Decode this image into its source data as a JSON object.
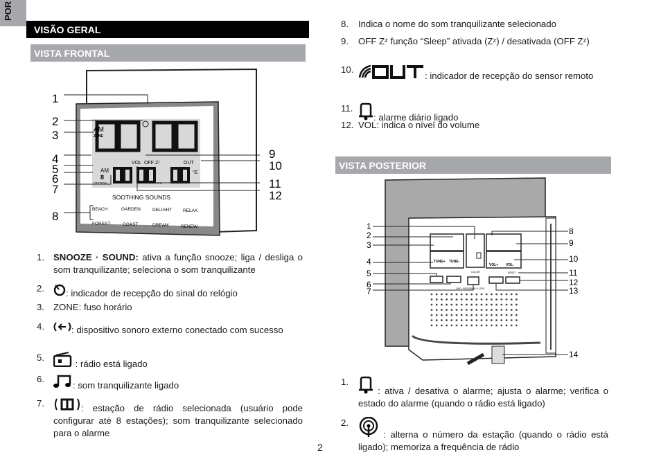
{
  "language_tab": "POR",
  "section_title": "VISÃO GERAL",
  "front_view": {
    "title": "VISTA FRONTAL",
    "diagram": {
      "callouts": [
        "1",
        "2",
        "3",
        "4",
        "5",
        "6",
        "7",
        "8",
        "9",
        "10",
        "11",
        "12"
      ],
      "lcd": {
        "am": "AM",
        "zone": "ZONE",
        "vol": "VOL",
        "off_zz": "OFF Zᶻ",
        "out": "OUT",
        "station": "STATION",
        "station_num": "8",
        "am2": "AM",
        "khz": "KHz",
        "unit": "°E"
      },
      "soothing_sounds": "SOOTHING SOUNDS",
      "sounds": [
        "BEACH",
        "GARDEN",
        "DELIGHT",
        "RELAX",
        "FOREST",
        "COAST",
        "DREAM",
        "RENEW"
      ]
    },
    "items": [
      {
        "num": "1.",
        "bold": "SNOOZE · SOUND:",
        "text": " ativa a função snooze; liga / desliga o som tranquilizante; seleciona o som tranquilizante"
      },
      {
        "num": "2.",
        "icon": "radio-signal-icon",
        "text": ": indicador de recepção do sinal do relógio"
      },
      {
        "num": "3.",
        "text": "ZONE: fuso horário"
      },
      {
        "num": "4.",
        "icon": "external-device-icon",
        "text": ": dispositivo sonoro externo conectado com sucesso"
      },
      {
        "num": "5.",
        "icon": "radio-icon",
        "text": " : rádio está ligado"
      },
      {
        "num": "6.",
        "icon": "music-note-icon",
        "text": ": som tranquilizante ligado"
      },
      {
        "num": "7.",
        "icon": "station-icon",
        "text": ": estação de rádio selecionada (usuário pode configurar até 8 estações); som tranquilizante selecionado para o alarme"
      }
    ]
  },
  "front_items_right": [
    {
      "num": "8.",
      "text": "Indica o nome do som tranquilizante selecionado"
    },
    {
      "num": "9.",
      "text": "OFF Zᶻ função “Sleep” ativada (Zᶻ) / desativada (OFF Zᶻ)"
    },
    {
      "num": "10.",
      "icon": "remote-sensor-out-icon",
      "text": ": indicador de recepção do sensor remoto"
    },
    {
      "num": "11.",
      "icon": "bell-icon",
      "text": ": alarme diário ligado"
    },
    {
      "num": "12.",
      "text": "VOL: indica o nível do volume"
    }
  ],
  "rear_view": {
    "title": "VISTA POSTERIOR",
    "diagram": {
      "callouts": [
        "1",
        "2",
        "3",
        "4",
        "5",
        "6",
        "7",
        "8",
        "9",
        "10",
        "11",
        "12",
        "13",
        "14"
      ],
      "buttons": {
        "tune_plus": "TUNE+",
        "tune_minus": "TUNE-",
        "vol_plus": "VOL+",
        "vol_minus": "VOL-",
        "color": "COLOR",
        "reset": "RESET",
        "mode_line": "OFF • PROGRAM • LOOP"
      }
    },
    "items": [
      {
        "num": "1.",
        "icon": "bell-icon",
        "text": " : ativa / desativa o alarme; ajusta o alarme; verifica o estado do alarme (quando o rádio está ligado)"
      },
      {
        "num": "2.",
        "icon": "station-memory-icon",
        "text": " : alterna o número da estação (quando o rádio está ligado); memoriza a frequência de rádio"
      }
    ]
  },
  "page_number": "2"
}
